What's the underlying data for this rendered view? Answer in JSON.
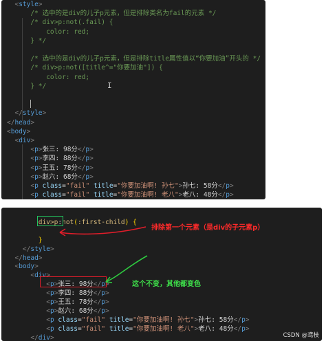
{
  "panel1": {
    "lines": [
      {
        "indent": "  ",
        "parts": [
          [
            "br",
            "<"
          ],
          [
            "tag",
            "style"
          ],
          [
            "br",
            ">"
          ]
        ]
      },
      {
        "indent": "      ",
        "parts": [
          [
            "cm",
            "/* 选中的是div的儿子p元素，但是排除类名为fail的元素 */"
          ]
        ]
      },
      {
        "indent": "      ",
        "parts": [
          [
            "cm",
            "/* div>p:not(.fail) {"
          ]
        ]
      },
      {
        "indent": "          ",
        "parts": [
          [
            "cm",
            "color: red;"
          ]
        ]
      },
      {
        "indent": "      ",
        "parts": [
          [
            "cm",
            "} */"
          ]
        ]
      },
      {
        "indent": "",
        "parts": []
      },
      {
        "indent": "      ",
        "parts": [
          [
            "cm",
            "/* 选中的是div的儿子p元素，但是排除title属性值以“你要加油”开头的 */"
          ]
        ]
      },
      {
        "indent": "      ",
        "parts": [
          [
            "cm",
            "/* div>p:not([title^=\"你要加油\"]) {"
          ]
        ]
      },
      {
        "indent": "          ",
        "parts": [
          [
            "cm",
            "color: red;"
          ]
        ]
      },
      {
        "indent": "      ",
        "parts": [
          [
            "cm",
            "} */"
          ]
        ]
      },
      {
        "indent": "",
        "parts": []
      },
      {
        "indent": "",
        "parts": []
      },
      {
        "indent": "  ",
        "parts": [
          [
            "br",
            "</"
          ],
          [
            "tag",
            "style"
          ],
          [
            "br",
            ">"
          ]
        ]
      },
      {
        "indent": "",
        "parts": [
          [
            "br",
            "</"
          ],
          [
            "tag",
            "head"
          ],
          [
            "br",
            ">"
          ]
        ]
      },
      {
        "indent": "",
        "parts": [
          [
            "br",
            "<"
          ],
          [
            "tag",
            "body"
          ],
          [
            "br",
            ">"
          ]
        ]
      },
      {
        "indent": "  ",
        "parts": [
          [
            "br",
            "<"
          ],
          [
            "tag",
            "div"
          ],
          [
            "br",
            ">"
          ]
        ]
      },
      {
        "indent": "      ",
        "parts": [
          [
            "br",
            "<"
          ],
          [
            "tag",
            "p"
          ],
          [
            "br",
            ">"
          ],
          [
            "txt",
            "张三: 98分"
          ],
          [
            "br",
            "</"
          ],
          [
            "tag",
            "p"
          ],
          [
            "br",
            ">"
          ]
        ]
      },
      {
        "indent": "      ",
        "parts": [
          [
            "br",
            "<"
          ],
          [
            "tag",
            "p"
          ],
          [
            "br",
            ">"
          ],
          [
            "txt",
            "李四: 88分"
          ],
          [
            "br",
            "</"
          ],
          [
            "tag",
            "p"
          ],
          [
            "br",
            ">"
          ]
        ]
      },
      {
        "indent": "      ",
        "parts": [
          [
            "br",
            "<"
          ],
          [
            "tag",
            "p"
          ],
          [
            "br",
            ">"
          ],
          [
            "txt",
            "王五: 78分"
          ],
          [
            "br",
            "</"
          ],
          [
            "tag",
            "p"
          ],
          [
            "br",
            ">"
          ]
        ]
      },
      {
        "indent": "      ",
        "parts": [
          [
            "br",
            "<"
          ],
          [
            "tag",
            "p"
          ],
          [
            "br",
            ">"
          ],
          [
            "txt",
            "赵六: 68分"
          ],
          [
            "br",
            "</"
          ],
          [
            "tag",
            "p"
          ],
          [
            "br",
            ">"
          ]
        ]
      },
      {
        "indent": "      ",
        "parts": [
          [
            "br",
            "<"
          ],
          [
            "tag",
            "p"
          ],
          [
            "txt",
            " "
          ],
          [
            "attr",
            "class"
          ],
          [
            "txt",
            "="
          ],
          [
            "str",
            "\"fail\""
          ],
          [
            "txt",
            " "
          ],
          [
            "attr",
            "title"
          ],
          [
            "txt",
            "="
          ],
          [
            "str",
            "\"你要加油啊! 孙七\""
          ],
          [
            "br",
            ">"
          ],
          [
            "txt",
            "孙七: 58分"
          ],
          [
            "br",
            "</"
          ],
          [
            "tag",
            "p"
          ],
          [
            "br",
            ">"
          ]
        ]
      },
      {
        "indent": "      ",
        "parts": [
          [
            "br",
            "<"
          ],
          [
            "tag",
            "p"
          ],
          [
            "txt",
            " "
          ],
          [
            "attr",
            "class"
          ],
          [
            "txt",
            "="
          ],
          [
            "str",
            "\"fail\""
          ],
          [
            "txt",
            " "
          ],
          [
            "attr",
            "title"
          ],
          [
            "txt",
            "="
          ],
          [
            "str",
            "\"你要加油啊! 老八\""
          ],
          [
            "br",
            ">"
          ],
          [
            "txt",
            "老八: 48分"
          ],
          [
            "br",
            "</"
          ],
          [
            "tag",
            "p"
          ],
          [
            "br",
            ">"
          ]
        ]
      }
    ]
  },
  "panel2": {
    "lines": [
      {
        "indent": "",
        "parts": []
      },
      {
        "indent": "        ",
        "parts": [
          [
            "sel",
            "div>p"
          ],
          [
            "txt",
            ":"
          ],
          [
            "sel",
            "not"
          ],
          [
            "brace",
            "("
          ],
          [
            "sel",
            ":first-child"
          ],
          [
            "brace",
            ")"
          ],
          [
            "txt",
            " "
          ],
          [
            "brace",
            "{"
          ]
        ]
      },
      {
        "indent": "",
        "parts": []
      },
      {
        "indent": "        ",
        "parts": [
          [
            "brace",
            "}"
          ]
        ]
      },
      {
        "indent": "    ",
        "parts": [
          [
            "br",
            "</"
          ],
          [
            "tag",
            "style"
          ],
          [
            "br",
            ">"
          ]
        ]
      },
      {
        "indent": "  ",
        "parts": [
          [
            "br",
            "</"
          ],
          [
            "tag",
            "head"
          ],
          [
            "br",
            ">"
          ]
        ]
      },
      {
        "indent": "  ",
        "parts": [
          [
            "br",
            "<"
          ],
          [
            "tag",
            "body"
          ],
          [
            "br",
            ">"
          ]
        ]
      },
      {
        "indent": "      ",
        "parts": [
          [
            "br",
            "<"
          ],
          [
            "tag",
            "div"
          ],
          [
            "br",
            ">"
          ]
        ]
      },
      {
        "indent": "          ",
        "parts": [
          [
            "br",
            "<"
          ],
          [
            "tag",
            "p"
          ],
          [
            "br",
            ">"
          ],
          [
            "txt",
            "张三: 98分"
          ],
          [
            "br",
            "</"
          ],
          [
            "tag",
            "p"
          ],
          [
            "br",
            ">"
          ]
        ]
      },
      {
        "indent": "          ",
        "parts": [
          [
            "br",
            "<"
          ],
          [
            "tag",
            "p"
          ],
          [
            "br",
            ">"
          ],
          [
            "txt",
            "李四: 88分"
          ],
          [
            "br",
            "</"
          ],
          [
            "tag",
            "p"
          ],
          [
            "br",
            ">"
          ]
        ]
      },
      {
        "indent": "          ",
        "parts": [
          [
            "br",
            "<"
          ],
          [
            "tag",
            "p"
          ],
          [
            "br",
            ">"
          ],
          [
            "txt",
            "王五: 78分"
          ],
          [
            "br",
            "</"
          ],
          [
            "tag",
            "p"
          ],
          [
            "br",
            ">"
          ]
        ]
      },
      {
        "indent": "          ",
        "parts": [
          [
            "br",
            "<"
          ],
          [
            "tag",
            "p"
          ],
          [
            "br",
            ">"
          ],
          [
            "txt",
            "赵六: 68分"
          ],
          [
            "br",
            "</"
          ],
          [
            "tag",
            "p"
          ],
          [
            "br",
            ">"
          ]
        ]
      },
      {
        "indent": "          ",
        "parts": [
          [
            "br",
            "<"
          ],
          [
            "tag",
            "p"
          ],
          [
            "txt",
            " "
          ],
          [
            "attr",
            "class"
          ],
          [
            "txt",
            "="
          ],
          [
            "str",
            "\"fail\""
          ],
          [
            "txt",
            " "
          ],
          [
            "attr",
            "title"
          ],
          [
            "txt",
            "="
          ],
          [
            "str",
            "\"你要加油啊! 孙七\""
          ],
          [
            "br",
            ">"
          ],
          [
            "txt",
            "孙七: 58分"
          ],
          [
            "br",
            "</"
          ],
          [
            "tag",
            "p"
          ],
          [
            "br",
            ">"
          ]
        ]
      },
      {
        "indent": "          ",
        "parts": [
          [
            "br",
            "<"
          ],
          [
            "tag",
            "p"
          ],
          [
            "txt",
            " "
          ],
          [
            "attr",
            "class"
          ],
          [
            "txt",
            "="
          ],
          [
            "str",
            "\"fail\""
          ],
          [
            "txt",
            " "
          ],
          [
            "attr",
            "title"
          ],
          [
            "txt",
            "="
          ],
          [
            "str",
            "\"你要加油啊! 老八\""
          ],
          [
            "br",
            ">"
          ],
          [
            "txt",
            "老八: 48分"
          ],
          [
            "br",
            "</"
          ],
          [
            "tag",
            "p"
          ],
          [
            "br",
            ">"
          ]
        ]
      },
      {
        "indent": "      ",
        "parts": [
          [
            "br",
            "</"
          ],
          [
            "tag",
            "div"
          ],
          [
            "br",
            ">"
          ]
        ]
      }
    ]
  },
  "annotations": {
    "red_note": "排除第一个元素（是div的子元素p）",
    "green_note": "这个不变，其他都变色"
  },
  "watermark": "CSDN @鸢枝"
}
